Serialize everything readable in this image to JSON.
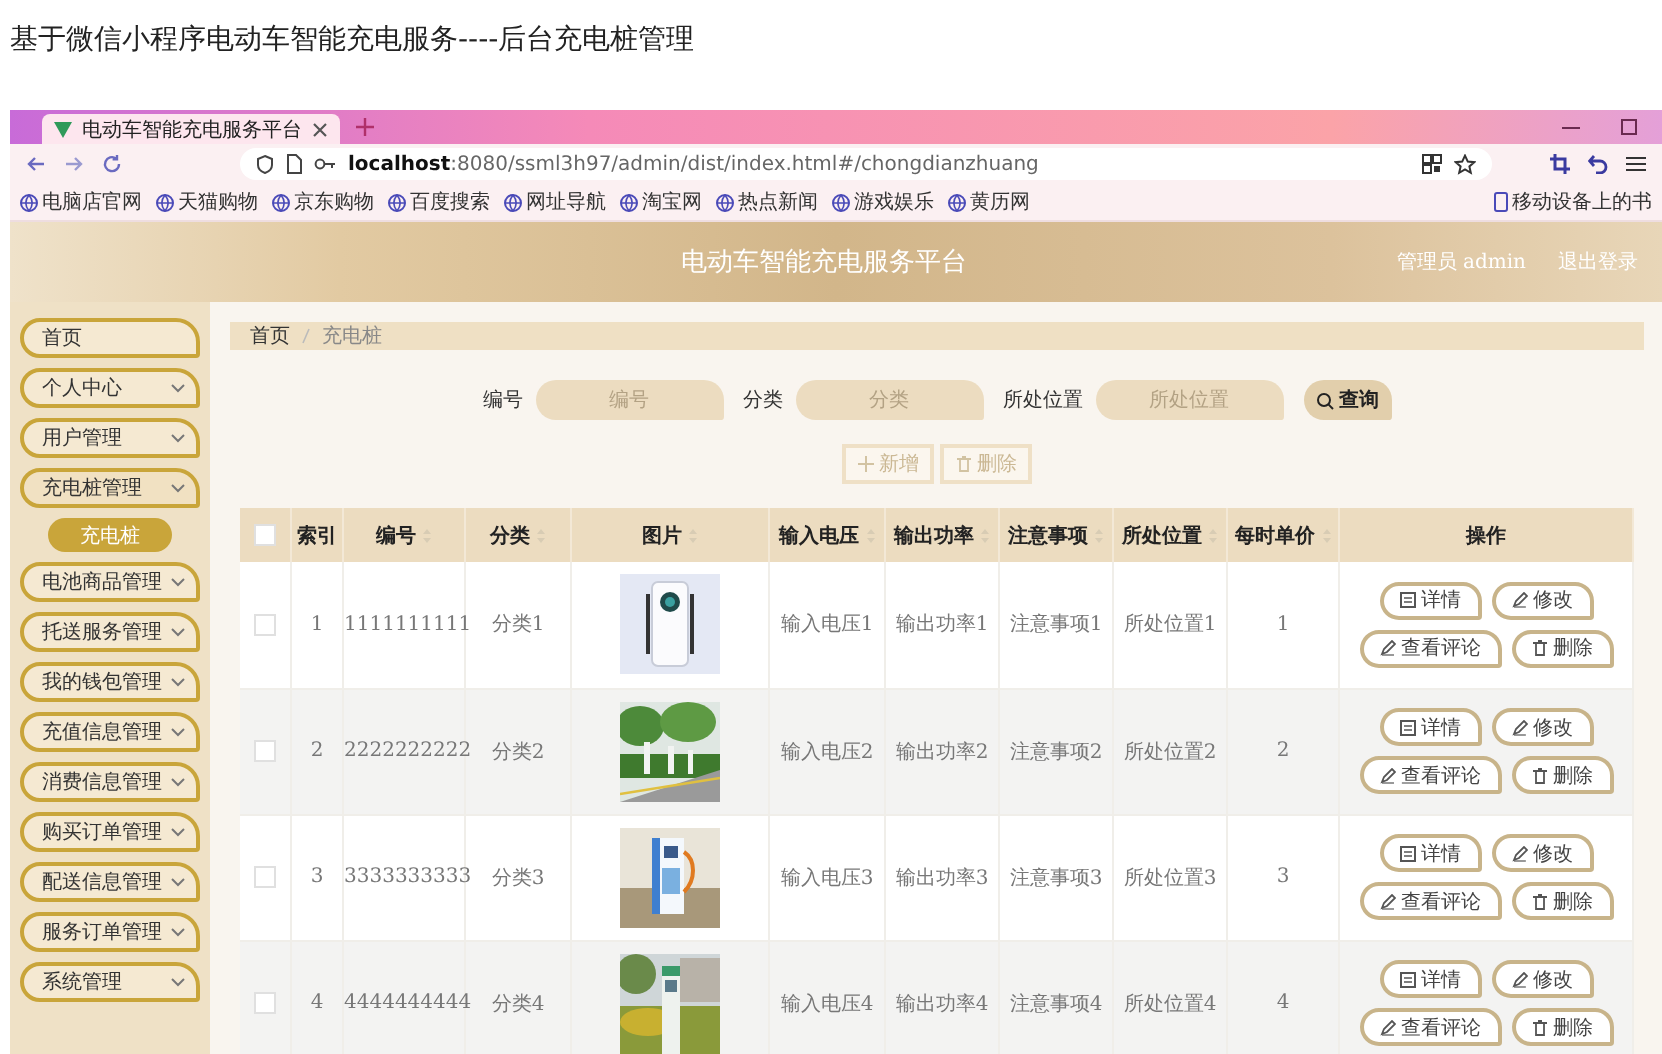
{
  "page_title": "基于微信小程序电动车智能充电服务----后台充电桩管理",
  "browser": {
    "tab": {
      "title": "电动车智能充电服务平台"
    },
    "address": {
      "host": "localhost",
      "path": ":8080/ssml3h97/admin/dist/index.html#/chongdianzhuang"
    },
    "bookmarks": [
      "电脑店官网",
      "天猫购物",
      "京东购物",
      "百度搜索",
      "网址导航",
      "淘宝网",
      "热点新闻",
      "游戏娱乐",
      "黄历网"
    ],
    "mobile_bookmarks": "移动设备上的书"
  },
  "header": {
    "title": "电动车智能充电服务平台",
    "user": "管理员 admin",
    "logout": "退出登录"
  },
  "sidebar": {
    "items": [
      {
        "label": "首页",
        "kind": "link"
      },
      {
        "label": "个人中心",
        "kind": "menu",
        "expanded": false
      },
      {
        "label": "用户管理",
        "kind": "menu",
        "expanded": false
      },
      {
        "label": "充电桩管理",
        "kind": "menu",
        "expanded": true,
        "children": [
          {
            "label": "充电桩",
            "selected": true
          }
        ]
      },
      {
        "label": "电池商品管理",
        "kind": "menu",
        "expanded": false
      },
      {
        "label": "托送服务管理",
        "kind": "menu",
        "expanded": false
      },
      {
        "label": "我的钱包管理",
        "kind": "menu",
        "expanded": false
      },
      {
        "label": "充值信息管理",
        "kind": "menu",
        "expanded": false
      },
      {
        "label": "消费信息管理",
        "kind": "menu",
        "expanded": false
      },
      {
        "label": "购买订单管理",
        "kind": "menu",
        "expanded": false
      },
      {
        "label": "配送信息管理",
        "kind": "menu",
        "expanded": false
      },
      {
        "label": "服务订单管理",
        "kind": "menu",
        "expanded": false
      },
      {
        "label": "系统管理",
        "kind": "menu",
        "expanded": false
      }
    ]
  },
  "breadcrumb": [
    "首页",
    "充电桩"
  ],
  "search": {
    "fields": [
      {
        "label": "编号",
        "placeholder": "编号"
      },
      {
        "label": "分类",
        "placeholder": "分类"
      },
      {
        "label": "所处位置",
        "placeholder": "所处位置"
      }
    ],
    "button": "查询"
  },
  "actions": [
    {
      "label": "新增",
      "kind": "add",
      "disabled": true
    },
    {
      "label": "删除",
      "kind": "delete",
      "disabled": true
    }
  ],
  "table": {
    "all_selected": false,
    "columns": [
      {
        "label": "索引",
        "kind": "text",
        "sortable": false
      },
      {
        "label": "编号",
        "kind": "text",
        "sortable": true
      },
      {
        "label": "分类",
        "kind": "text",
        "sortable": true
      },
      {
        "label": "图片",
        "kind": "picture",
        "sortable": true
      },
      {
        "label": "输入电压",
        "kind": "text",
        "sortable": true
      },
      {
        "label": "输出功率",
        "kind": "text",
        "sortable": true
      },
      {
        "label": "注意事项",
        "kind": "text",
        "sortable": true
      },
      {
        "label": "所处位置",
        "kind": "text",
        "sortable": true
      },
      {
        "label": "每时单价",
        "kind": "text",
        "sortable": true
      },
      {
        "label": "操作",
        "kind": "actions",
        "sortable": false
      }
    ],
    "rows": [
      {
        "selected": false,
        "cells": [
          "1",
          "1111111111",
          "分类1",
          {
            "kind": "picture"
          },
          "输入电压1",
          "输出功率1",
          "注意事项1",
          "所处位置1",
          "1",
          [
            {
              "label": "详情",
              "kind": "detail"
            },
            {
              "label": "修改",
              "kind": "edit"
            },
            {
              "label": "查看评论",
              "kind": "comment"
            },
            {
              "label": "删除",
              "kind": "delete"
            }
          ]
        ]
      },
      {
        "selected": false,
        "cells": [
          "2",
          "2222222222",
          "分类2",
          {
            "kind": "picture"
          },
          "输入电压2",
          "输出功率2",
          "注意事项2",
          "所处位置2",
          "2",
          [
            {
              "label": "详情",
              "kind": "detail"
            },
            {
              "label": "修改",
              "kind": "edit"
            },
            {
              "label": "查看评论",
              "kind": "comment"
            },
            {
              "label": "删除",
              "kind": "delete"
            }
          ]
        ]
      },
      {
        "selected": false,
        "cells": [
          "3",
          "3333333333",
          "分类3",
          {
            "kind": "picture"
          },
          "输入电压3",
          "输出功率3",
          "注意事项3",
          "所处位置3",
          "3",
          [
            {
              "label": "详情",
              "kind": "detail"
            },
            {
              "label": "修改",
              "kind": "edit"
            },
            {
              "label": "查看评论",
              "kind": "comment"
            },
            {
              "label": "删除",
              "kind": "delete"
            }
          ]
        ]
      },
      {
        "selected": false,
        "cells": [
          "4",
          "4444444444",
          "分类4",
          {
            "kind": "picture"
          },
          "输入电压4",
          "输出功率4",
          "注意事项4",
          "所处位置4",
          "4",
          [
            {
              "label": "详情",
              "kind": "detail"
            },
            {
              "label": "修改",
              "kind": "edit"
            },
            {
              "label": "查看评论",
              "kind": "comment"
            },
            {
              "label": "删除",
              "kind": "delete"
            }
          ]
        ]
      }
    ]
  }
}
